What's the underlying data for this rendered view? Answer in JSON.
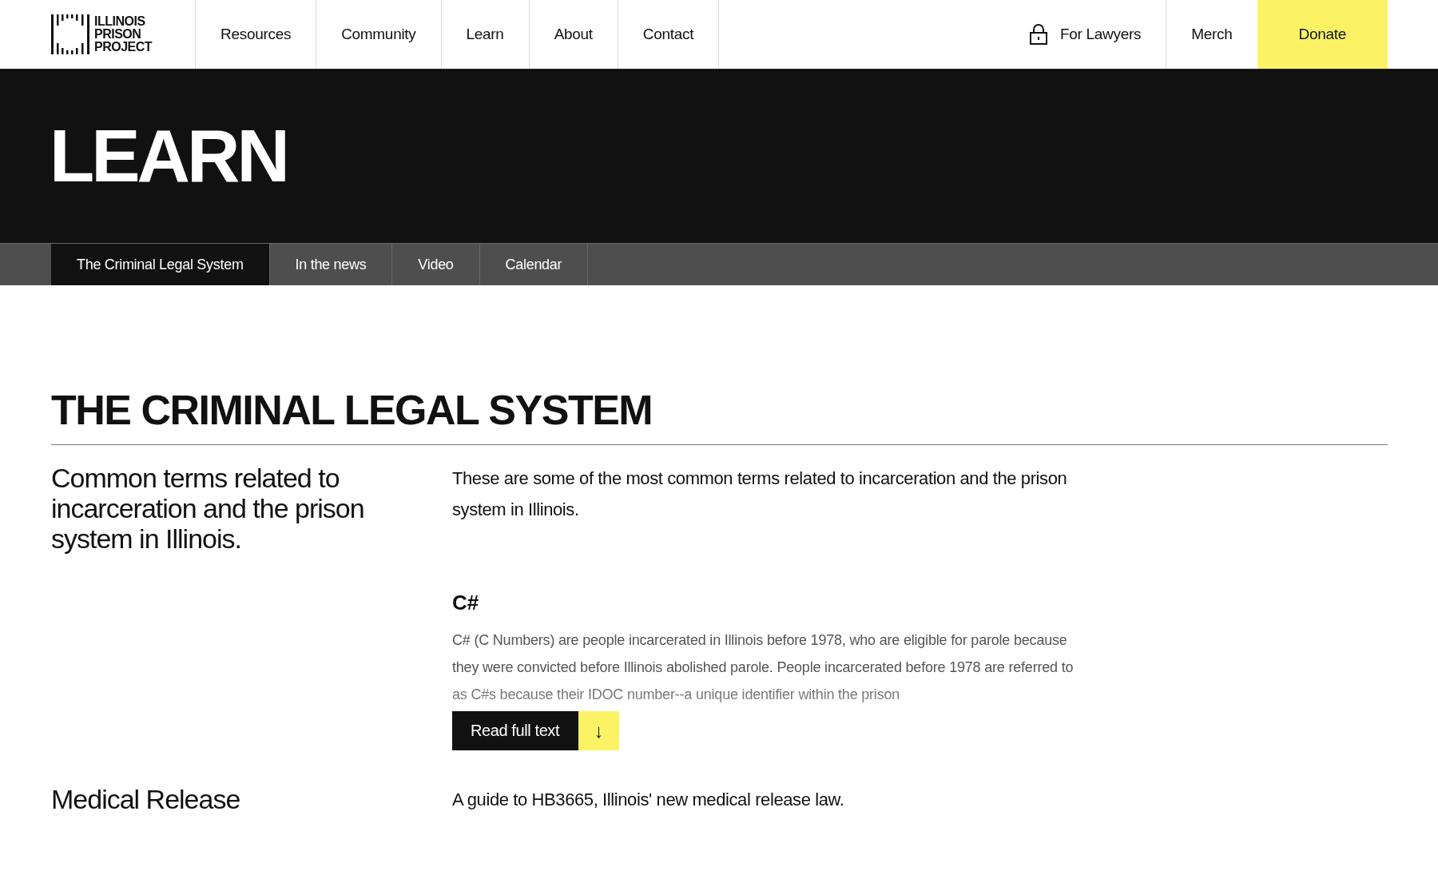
{
  "header": {
    "logo_text": "ILLINOIS PRISON PROJECT",
    "nav": [
      {
        "label": "Resources"
      },
      {
        "label": "Community"
      },
      {
        "label": "Learn"
      },
      {
        "label": "About"
      },
      {
        "label": "Contact"
      }
    ],
    "actions": [
      {
        "kind": "locked",
        "label": "For Lawyers"
      },
      {
        "kind": "link",
        "label": "Merch"
      },
      {
        "kind": "donate",
        "label": "Donate"
      }
    ]
  },
  "hero": {
    "title": "LEARN"
  },
  "tabs": [
    {
      "label": "The Criminal Legal System",
      "selected": true
    },
    {
      "label": "In the news",
      "selected": false
    },
    {
      "label": "Video",
      "selected": false
    },
    {
      "label": "Calendar",
      "selected": false
    }
  ],
  "page_title": "THE CRIMINAL LEGAL SYSTEM",
  "sections": [
    {
      "title": "Common terms related to incarceration and the prison system in Illinois.",
      "intro": "These are some of the most common terms related to incarceration and the prison system in Illinois.",
      "terms": [
        {
          "term": "C#",
          "text": "C# (C Numbers) are people incarcerated in Illinois before 1978, who are eligible for parole because they were convicted before Illinois abolished parole. People incarcerated before 1978 are referred to as C#s because their IDOC number--a unique identifier within the prison",
          "button": "Read full text",
          "button_icon": "↓"
        }
      ]
    },
    {
      "title": "Medical Release",
      "intro": "A guide to HB3665, Illinois' new medical release law."
    }
  ]
}
